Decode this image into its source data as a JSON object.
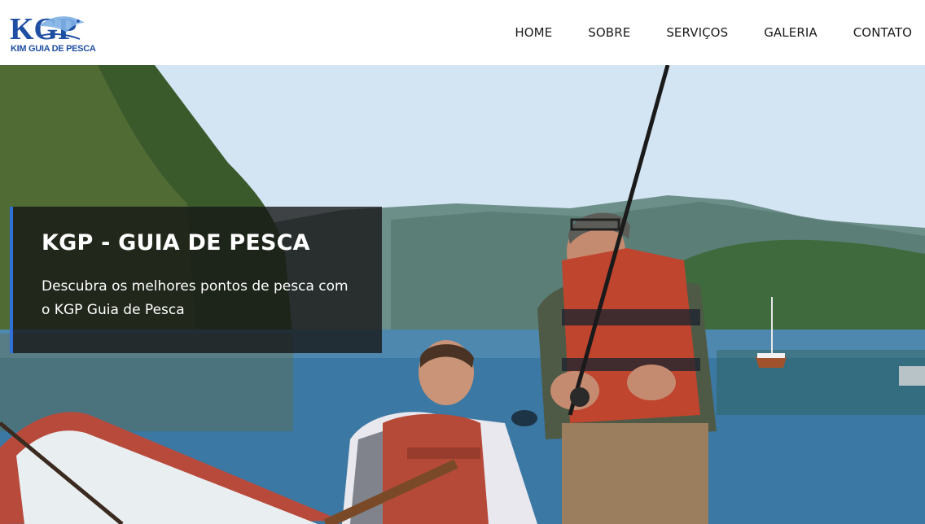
{
  "brand": {
    "logo_letters": "KGP",
    "logo_text": "KIM GUIA DE PESCA"
  },
  "nav": {
    "items": [
      {
        "label": "HOME"
      },
      {
        "label": "SOBRE"
      },
      {
        "label": "SERVIÇOS"
      },
      {
        "label": "GALERIA"
      },
      {
        "label": "CONTATO"
      }
    ]
  },
  "hero": {
    "title": "KGP - GUIA DE PESCA",
    "subtitle": "Descubra os melhores pontos de pesca com o KGP Guia de Pesca"
  },
  "colors": {
    "accent": "#2f6fd6",
    "logo_blue": "#1f4fa3",
    "caption_bg": "rgba(20,20,20,0.78)"
  }
}
